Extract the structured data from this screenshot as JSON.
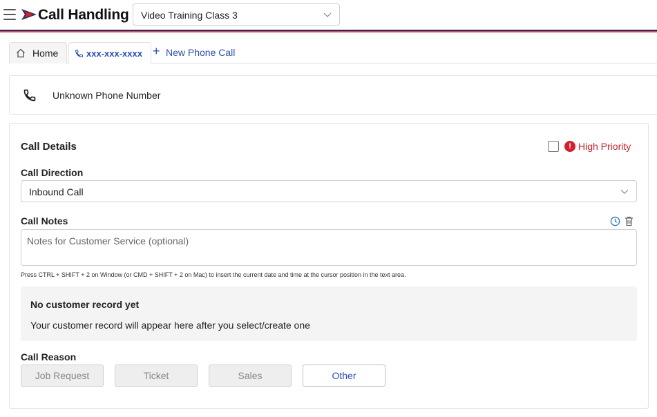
{
  "header": {
    "app_title": "Call Handling",
    "workspace_value": "Video Training Class 3",
    "stripe_colors": [
      "#1f2d5c",
      "#d84a54"
    ]
  },
  "tabs": [
    {
      "label": "Home",
      "icon": "home-icon"
    },
    {
      "label": "xxx-xxx-xxxx",
      "icon": "phone-icon"
    },
    {
      "label": "New Phone Call",
      "icon": "plus-icon"
    }
  ],
  "phone_card": {
    "label": "Unknown Phone Number",
    "icon": "phone-icon"
  },
  "call_details": {
    "title": "Call Details",
    "high_priority_label": "High Priority",
    "high_priority_checked": false,
    "call_direction_label": "Call Direction",
    "call_direction_value": "Inbound Call",
    "call_notes_label": "Call Notes",
    "call_notes_placeholder": "Notes for Customer Service (optional)",
    "call_notes_value": "",
    "hint": "Press CTRL + SHIFT + 2 on Window (or CMD + SHIFT + 2 on Mac) to insert the current date and time at the cursor position in the text area.",
    "empty_record_title": "No customer record yet",
    "empty_record_text": "Your customer record will appear here after you select/create one",
    "call_reason_label": "Call Reason",
    "call_reasons": [
      "Job Request",
      "Ticket",
      "Sales",
      "Other"
    ],
    "selected_reason": "Other"
  },
  "colors": {
    "accent": "#2b4bc4",
    "priority": "#d4202c"
  }
}
